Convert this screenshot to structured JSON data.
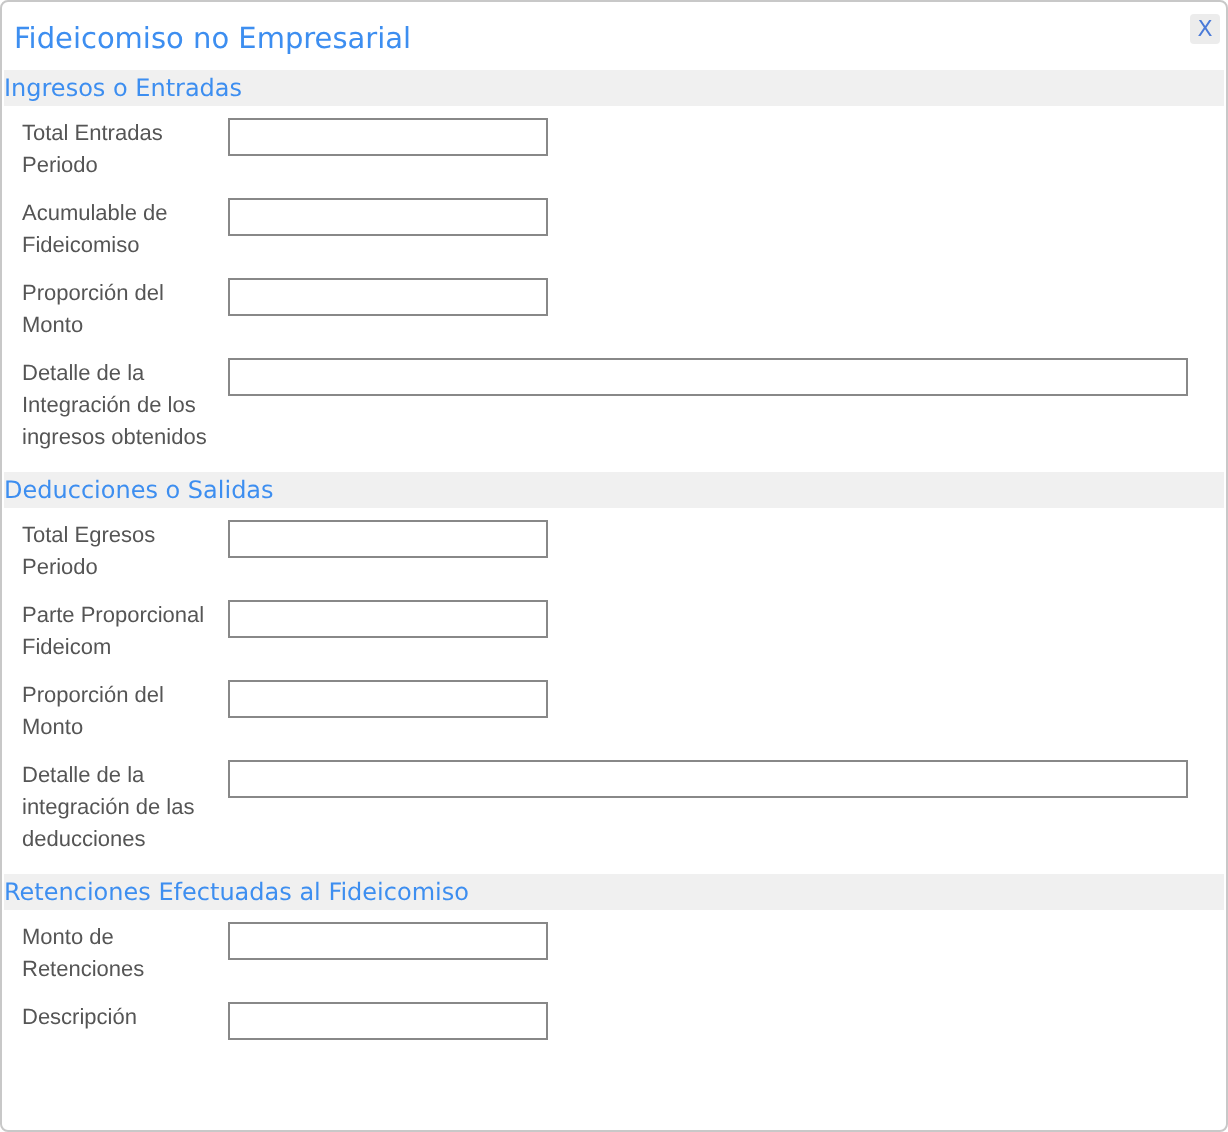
{
  "window": {
    "title": "Fideicomiso no Empresarial",
    "close": "X"
  },
  "sections": [
    {
      "title": "Ingresos o Entradas",
      "fields": [
        {
          "label": "Total Entradas Periodo",
          "kind": "short"
        },
        {
          "label": "Acumulable de Fideicomiso",
          "kind": "short"
        },
        {
          "label": "Proporción del Monto",
          "kind": "short"
        },
        {
          "label": "Detalle de la Integración de los ingresos obtenidos",
          "kind": "wide"
        }
      ]
    },
    {
      "title": "Deducciones o Salidas",
      "fields": [
        {
          "label": "Total Egresos Periodo",
          "kind": "short"
        },
        {
          "label": "Parte Proporcional Fideicom",
          "kind": "short"
        },
        {
          "label": "Proporción del Monto",
          "kind": "short"
        },
        {
          "label": "Detalle de la integración de las deducciones",
          "kind": "wide"
        }
      ]
    },
    {
      "title": "Retenciones Efectuadas al Fideicomiso",
      "fields": [
        {
          "label": "Monto de Retenciones",
          "kind": "short"
        },
        {
          "label": "Descripción",
          "kind": "short"
        }
      ]
    }
  ]
}
